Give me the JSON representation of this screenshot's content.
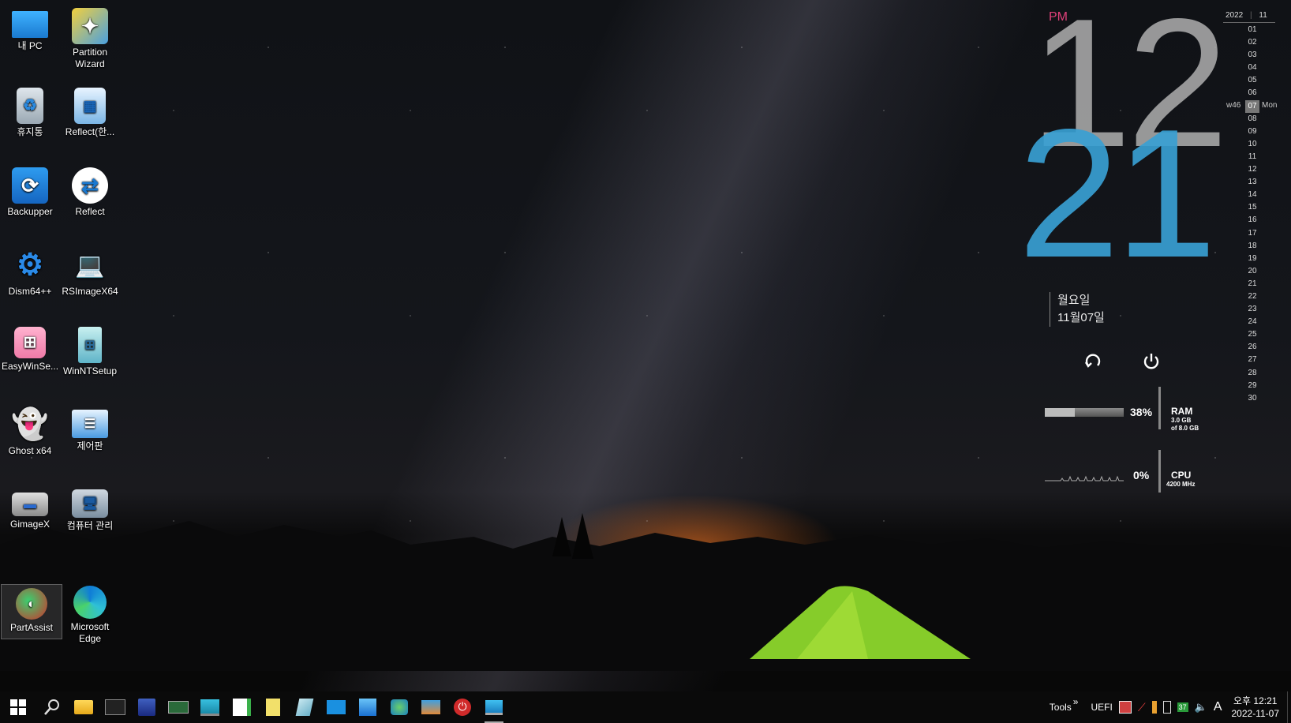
{
  "desktop": {
    "icons": [
      {
        "label": "내 PC"
      },
      {
        "label": "Partition Wizard"
      },
      {
        "label": "휴지통"
      },
      {
        "label": "Reflect(한..."
      },
      {
        "label": "Backupper"
      },
      {
        "label": "Reflect"
      },
      {
        "label": "Dism64++"
      },
      {
        "label": "RSImageX64"
      },
      {
        "label": "EasyWinSe..."
      },
      {
        "label": "WinNTSetup"
      },
      {
        "label": "Ghost x64"
      },
      {
        "label": "제어판"
      },
      {
        "label": "GimageX"
      },
      {
        "label": "컴퓨터 관리"
      },
      {
        "label": "PartAssist"
      },
      {
        "label": "Microsoft Edge"
      }
    ]
  },
  "clock_widget": {
    "ampm": "PM",
    "hour": "12",
    "minute": "21",
    "weekday": "월요일",
    "date": "11월07일"
  },
  "meters": {
    "ram": {
      "percent": "38%",
      "label": "RAM",
      "used": "3.0 GB",
      "total": "of 8.0 GB",
      "fill_fraction": 0.38
    },
    "cpu": {
      "percent": "0%",
      "label": "CPU",
      "speed": "4200 MHz"
    }
  },
  "calendar": {
    "year": "2022",
    "month": "11",
    "week": "w46",
    "today_weekday": "Mon",
    "today": "07",
    "days": [
      "01",
      "02",
      "03",
      "04",
      "05",
      "06",
      "07",
      "08",
      "09",
      "10",
      "11",
      "12",
      "13",
      "14",
      "15",
      "16",
      "17",
      "18",
      "19",
      "20",
      "21",
      "22",
      "23",
      "24",
      "25",
      "26",
      "27",
      "28",
      "29",
      "30"
    ]
  },
  "taskbar": {
    "pinned": [
      "start-icon",
      "search-icon",
      "file-explorer-icon",
      "terminal-icon",
      "save-disk-icon",
      "memory-chip-icon",
      "laptop-icon",
      "file-add-icon",
      "folder-file-icon",
      "notepad-icon",
      "window-icon",
      "photos-icon",
      "network-icon",
      "pc-tools-icon",
      "power-icon",
      "desktop-icon"
    ],
    "tray": {
      "tools_label": "Tools",
      "chevron": "»",
      "uefi_label": "UEFI",
      "battery_badge": "37",
      "ime": "A",
      "time": "오후 12:21",
      "date": "2022-11-07"
    }
  }
}
